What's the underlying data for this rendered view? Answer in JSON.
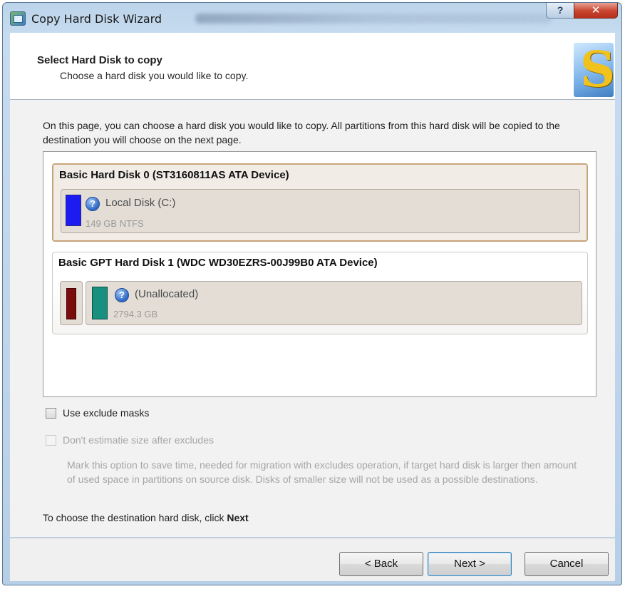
{
  "window": {
    "title": "Copy Hard Disk Wizard",
    "help_glyph": "?",
    "close_glyph": "✕"
  },
  "header": {
    "title": "Select Hard Disk to copy",
    "subtitle": "Choose a hard disk you would like to copy."
  },
  "intro_text": "On this page, you can choose a hard disk you would like to copy. All partitions from this hard disk will be copied to the destination you will choose on the next page.",
  "disks": [
    {
      "name": "Basic Hard Disk 0 (ST3160811AS ATA Device)",
      "selected": true,
      "partitions": [
        {
          "label": "Local Disk (C:)",
          "size": "149 GB NTFS",
          "color": "#1b1bf2"
        }
      ]
    },
    {
      "name": "Basic GPT Hard Disk 1 (WDC WD30EZRS-00J99B0 ATA Device)",
      "selected": false,
      "partitions": [
        {
          "label": "(Unallocated)",
          "size": "2794.3 GB",
          "color": "#188f7f"
        }
      ],
      "reserved_color": "#7a0c0c"
    }
  ],
  "options": {
    "use_exclude_masks": {
      "label": "Use exclude masks",
      "checked": false
    },
    "dont_estimate": {
      "label": "Don't estimatie size after excludes",
      "checked": false,
      "enabled": false
    },
    "hint": "Mark this option to save time, needed for migration with excludes operation, if target hard disk is larger then amount of used space in partitions on source disk. Disks of smaller size will not be used as a possible destinations."
  },
  "next_hint": {
    "prefix": "To choose the destination hard disk, click ",
    "action": "Next"
  },
  "buttons": {
    "back": "< Back",
    "next": "Next >",
    "cancel": "Cancel"
  },
  "icons": {
    "app": "copy-disk-icon",
    "logo": "wizard-logo-icon",
    "partition": "question-icon"
  }
}
